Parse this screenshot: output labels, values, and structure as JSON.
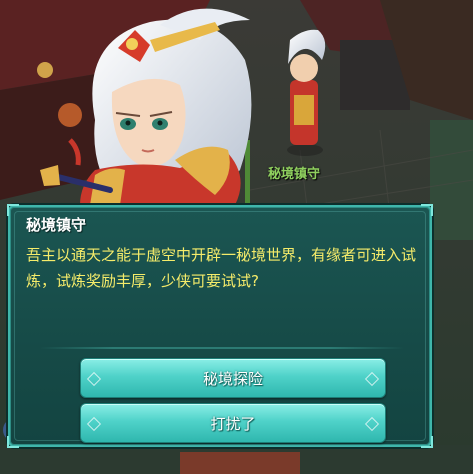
{
  "scene": {
    "npc_name": "秘境镇守"
  },
  "dialog": {
    "title": "秘境镇守",
    "message": "吾主以通天之能于虚空中开辟一秘境世界，有缘者可进入试炼，试炼奖励丰厚，少侠可要试试?",
    "options": [
      {
        "label": "秘境探险"
      },
      {
        "label": "打扰了"
      }
    ]
  },
  "colors": {
    "dialog_background": "#164a47",
    "dialog_border": "#3fb6ab",
    "message_text": "#f6ec6a",
    "title_text": "#ffffff",
    "button": "#4fd2c9",
    "npc_name_text": "#8fd05e"
  }
}
